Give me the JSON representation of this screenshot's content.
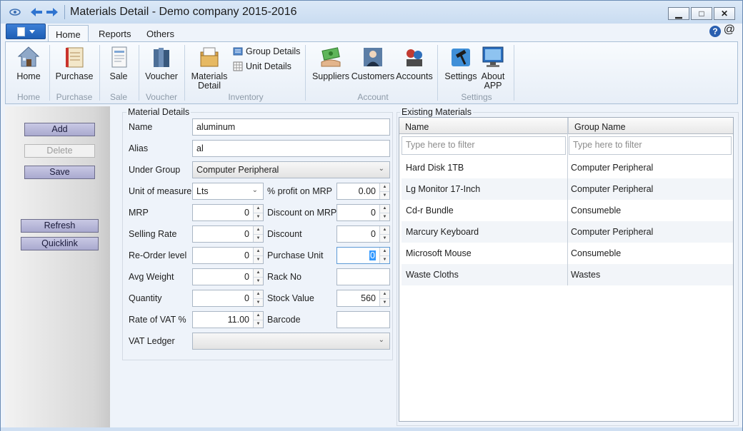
{
  "window": {
    "title": "Materials Detail - Demo company 2015-2016"
  },
  "title_buttons": {
    "minimize": "▁",
    "maximize": "□",
    "close": "✕"
  },
  "tabs": [
    {
      "label": "Home"
    },
    {
      "label": "Reports"
    },
    {
      "label": "Others"
    }
  ],
  "ribbon": {
    "buttons": {
      "home": "Home",
      "purchase": "Purchase",
      "sale": "Sale",
      "voucher": "Voucher",
      "materials_detail_1": "Materials",
      "materials_detail_2": "Detail",
      "group_details": "Group Details",
      "unit_details": "Unit Details",
      "suppliers": "Suppliers",
      "customers": "Customers",
      "accounts": "Accounts",
      "settings": "Settings",
      "about_1": "About",
      "about_2": "APP"
    },
    "groups": {
      "home": "Home",
      "purchase": "Purchase",
      "sale": "Sale",
      "voucher": "Voucher",
      "inventory": "Inventory",
      "account": "Account",
      "settings": "Settings"
    }
  },
  "left_panel": {
    "add": "Add",
    "delete": "Delete",
    "save": "Save",
    "refresh": "Refresh",
    "quicklink": "Quicklink"
  },
  "material_details": {
    "legend": "Material Details",
    "labels": {
      "name": "Name",
      "alias": "Alias",
      "under_group": "Under Group",
      "unit_of_measure": "Unit of measure",
      "profit_on_mrp": "% profit on MRP",
      "mrp": "MRP",
      "discount_on_mrp": "Discount on MRP",
      "selling_rate": "Selling Rate",
      "discount": "Discount",
      "reorder_level": "Re-Order level",
      "purchase_unit": "Purchase Unit",
      "avg_weight": "Avg Weight",
      "rack_no": "Rack No",
      "quantity": "Quantity",
      "stock_value": "Stock Value",
      "rate_of_vat": "Rate of VAT %",
      "barcode": "Barcode",
      "vat_ledger": "VAT Ledger"
    },
    "values": {
      "name": "aluminum",
      "alias": "al",
      "under_group": "Computer Peripheral",
      "unit_of_measure": "Lts",
      "profit_on_mrp": "0.00",
      "mrp": "0",
      "discount_on_mrp": "0",
      "selling_rate": "0",
      "discount": "0",
      "reorder_level": "0",
      "purchase_unit": "0",
      "avg_weight": "0",
      "rack_no": "",
      "quantity": "0",
      "stock_value": "560",
      "rate_of_vat": "11.00",
      "barcode": "",
      "vat_ledger": ""
    }
  },
  "existing_materials": {
    "legend": "Existing Materials",
    "columns": [
      "Name",
      "Group Name"
    ],
    "filter_placeholder": "Type here to filter",
    "rows": [
      [
        "Hard Disk 1TB",
        "Computer Peripheral"
      ],
      [
        "Lg Monitor 17-Inch",
        "Computer Peripheral"
      ],
      [
        "Cd-r Bundle",
        "Consumeble"
      ],
      [
        "Marcury Keyboard",
        "Computer Peripheral"
      ],
      [
        "Microsoft Mouse",
        "Consumeble"
      ],
      [
        "Waste Cloths",
        "Wastes"
      ]
    ]
  }
}
